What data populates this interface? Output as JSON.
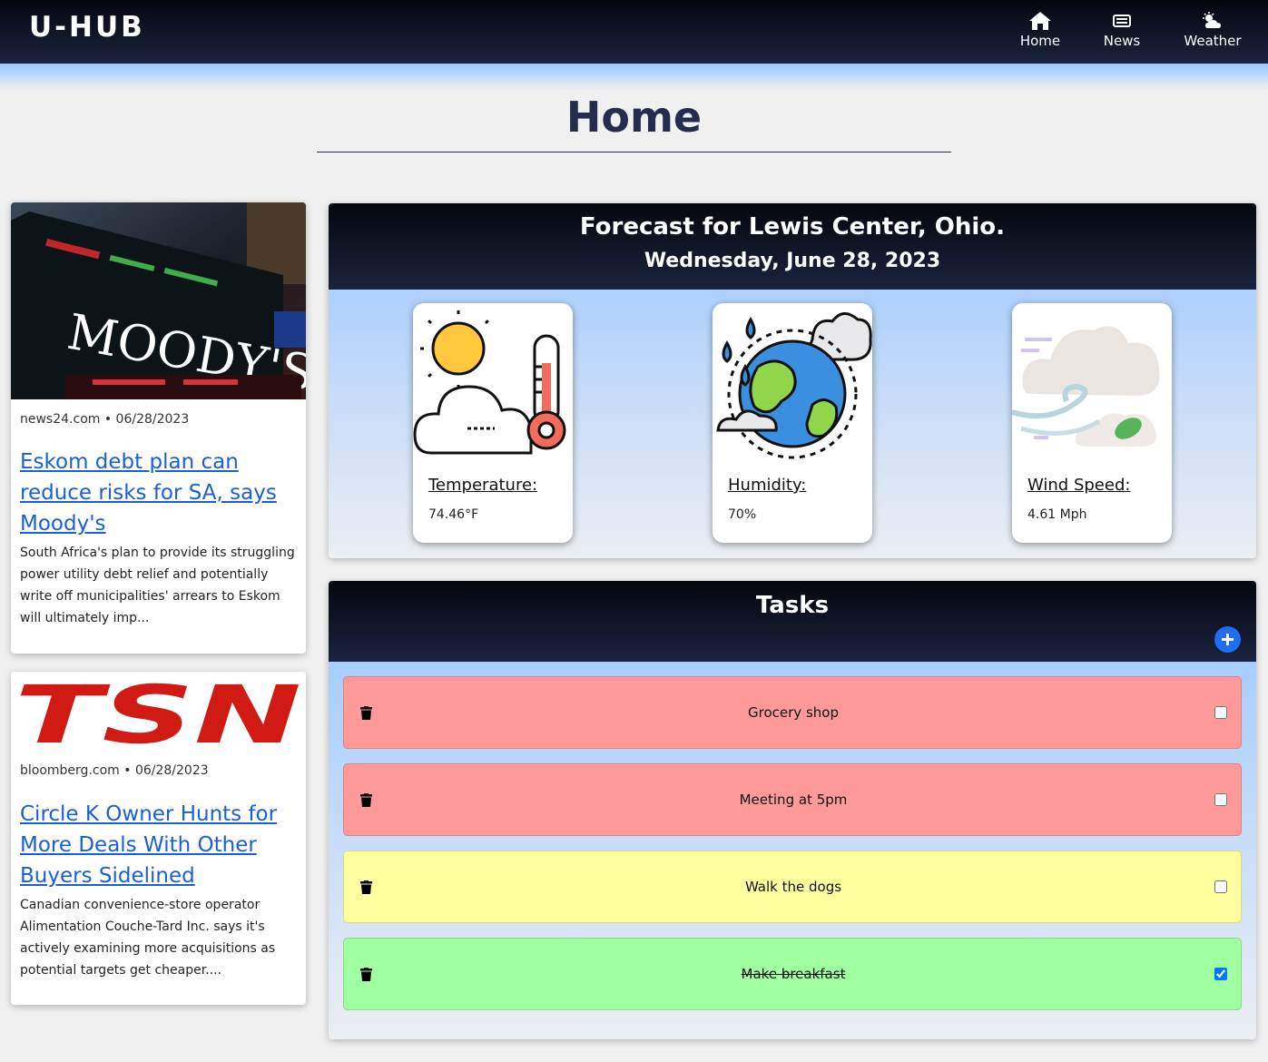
{
  "brand": "U-HUB",
  "nav": {
    "home": "Home",
    "news": "News",
    "weather": "Weather"
  },
  "page_title": "Home",
  "news": [
    {
      "source_date": "news24.com • 06/28/2023",
      "title": "Eskom debt plan can reduce risks for SA, says Moody's",
      "description": "South Africa's plan to provide its struggling power utility debt relief and potentially write off municipalities' arrears to Eskom will ultimately imp...",
      "image_text": "MOODY'S"
    },
    {
      "source_date": "bloomberg.com • 06/28/2023",
      "title": "Circle K Owner Hunts for More Deals With Other Buyers Sidelined",
      "description": "Canadian convenience-store operator Alimentation Couche-Tard Inc. says it's actively examining more acquisitions as potential targets get cheaper....",
      "image_text": "TSN"
    }
  ],
  "weather": {
    "title": "Forecast for Lewis Center, Ohio.",
    "date": "Wednesday, June 28, 2023",
    "cards": [
      {
        "label": "Temperature:",
        "value": "74.46°F",
        "icon": "sun-cloud-thermometer-icon"
      },
      {
        "label": "Humidity:",
        "value": "70%",
        "icon": "earth-raindrops-icon"
      },
      {
        "label": "Wind Speed:",
        "value": "4.61 Mph",
        "icon": "cloud-wind-icon"
      }
    ]
  },
  "tasks": {
    "title": "Tasks",
    "items": [
      {
        "text": "Grocery shop",
        "done": false,
        "color": "#ff9a9a"
      },
      {
        "text": "Meeting at 5pm",
        "done": false,
        "color": "#ff9a9a"
      },
      {
        "text": "Walk the dogs",
        "done": false,
        "color": "#ffffa0"
      },
      {
        "text": "Make breakfast",
        "done": true,
        "color": "#a0ffa0"
      }
    ]
  },
  "colors": {
    "navy": "#1b2340",
    "title": "#252c4e",
    "link": "#1a5fd6",
    "add_button": "#1f6df0"
  }
}
